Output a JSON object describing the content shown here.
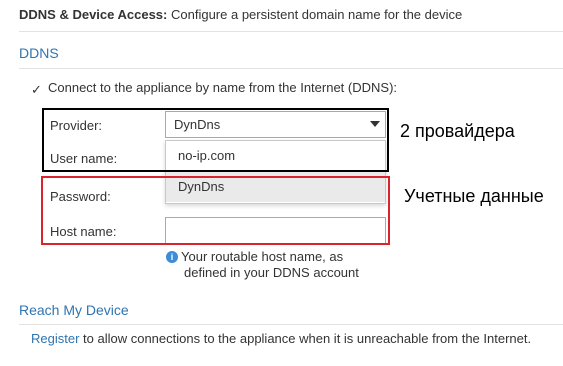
{
  "header": {
    "title": "DDNS & Device Access:",
    "description": "Configure a persistent domain name for the device"
  },
  "ddns": {
    "section_title": "DDNS",
    "checkbox_label": "Connect to the appliance by name from the Internet (DDNS):",
    "checkbox_checked": true,
    "provider_label": "Provider:",
    "provider_value": "DynDns",
    "provider_options": [
      "no-ip.com",
      "DynDns"
    ],
    "username_label": "User name:",
    "password_label": "Password:",
    "hostname_label": "Host name:",
    "hostname_value": "",
    "hint_line1": "Your routable host name, as",
    "hint_line2": "defined in your DDNS account"
  },
  "reach": {
    "section_title": "Reach My Device",
    "link_text": "Register",
    "text": " to allow connections to the appliance when it is unreachable from the Internet."
  },
  "annotations": {
    "providers_note": "2 провайдера",
    "credentials_note": "Учетные данные"
  },
  "colors": {
    "accent": "#2f74b0",
    "info_icon": "#3a8dd6",
    "annotation_black": "#000000",
    "annotation_red": "#d9232d"
  }
}
